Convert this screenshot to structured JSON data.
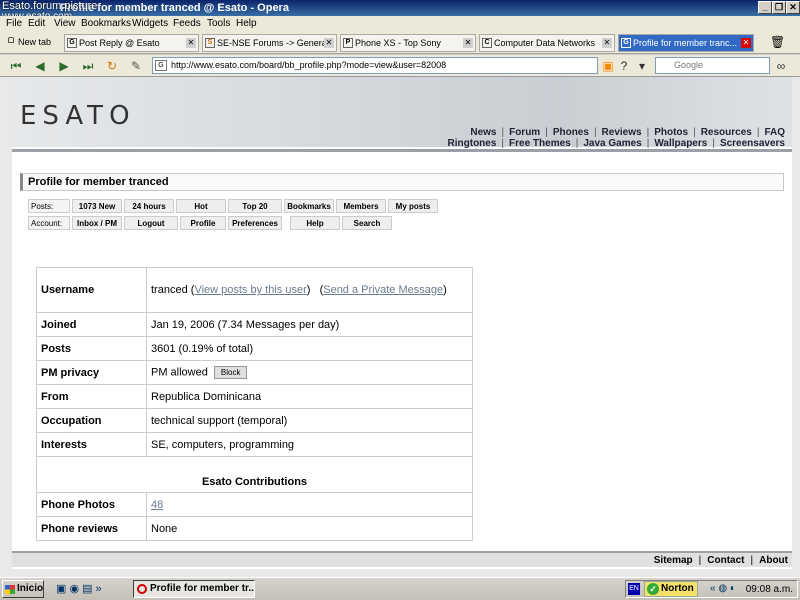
{
  "window": {
    "title": "Profile for member tranced @ Esato - Opera",
    "watermark_line1": "Esato.forum.picture",
    "watermark_line2": "www.esato.com"
  },
  "menu": [
    "File",
    "Edit",
    "View",
    "Bookmarks",
    "Widgets",
    "Feeds",
    "Tools",
    "Help"
  ],
  "tabs": {
    "new_tab": "New tab",
    "items": [
      {
        "label": "Post Reply @ Esato",
        "icon": "G"
      },
      {
        "label": "SE-NSE Forums -> General",
        "icon": "S"
      },
      {
        "label": "Phone XS - Top Sony",
        "icon": "P"
      },
      {
        "label": "Computer Data Networks",
        "icon": "C"
      },
      {
        "label": "Profile for member tranc...",
        "icon": "G"
      }
    ]
  },
  "address": {
    "url": "http://www.esato.com/board/bb_profile.php?mode=view&user=82008",
    "search_placeholder": "Google"
  },
  "site": {
    "logo": "ESATO",
    "nav1": [
      "News",
      "Forum",
      "Phones",
      "Reviews",
      "Photos",
      "Resources",
      "FAQ"
    ],
    "nav2": [
      "Ringtones",
      "Free Themes",
      "Java Games",
      "Wallpapers",
      "Screensavers"
    ],
    "page_title": "Profile for member tranced",
    "posts_label": "Posts:",
    "posts_buttons": [
      "1073 New",
      "24 hours",
      "Hot",
      "Top 20",
      "Bookmarks",
      "Members",
      "My posts"
    ],
    "account_label": "Account:",
    "account_buttons": [
      "Inbox / PM",
      "Logout",
      "Profile",
      "Preferences",
      "Help",
      "Search"
    ]
  },
  "profile": {
    "username_label": "Username",
    "username": "tranced",
    "view_posts": "View posts by this user",
    "send_pm": "Send a Private Message",
    "joined_label": "Joined",
    "joined": "Jan 19, 2006 (7.34 Messages per day)",
    "posts_label": "Posts",
    "posts": "3601 (0.19% of total)",
    "pm_label": "PM privacy",
    "pm": "PM allowed",
    "block": "Block",
    "from_label": "From",
    "from": "Republica Dominicana",
    "occupation_label": "Occupation",
    "occupation": "technical support (temporal)",
    "interests_label": "Interests",
    "interests": "SE, computers, programming",
    "contrib_header": "Esato Contributions",
    "photos_label": "Phone Photos",
    "photos": "48",
    "reviews_label": "Phone reviews",
    "reviews": "None"
  },
  "footer": [
    "Sitemap",
    "Contact",
    "About"
  ],
  "taskbar": {
    "start": "Inicio",
    "task": "Profile for member tr...",
    "lang": "EN",
    "norton": "Norton",
    "clock": "09:08 a.m."
  }
}
